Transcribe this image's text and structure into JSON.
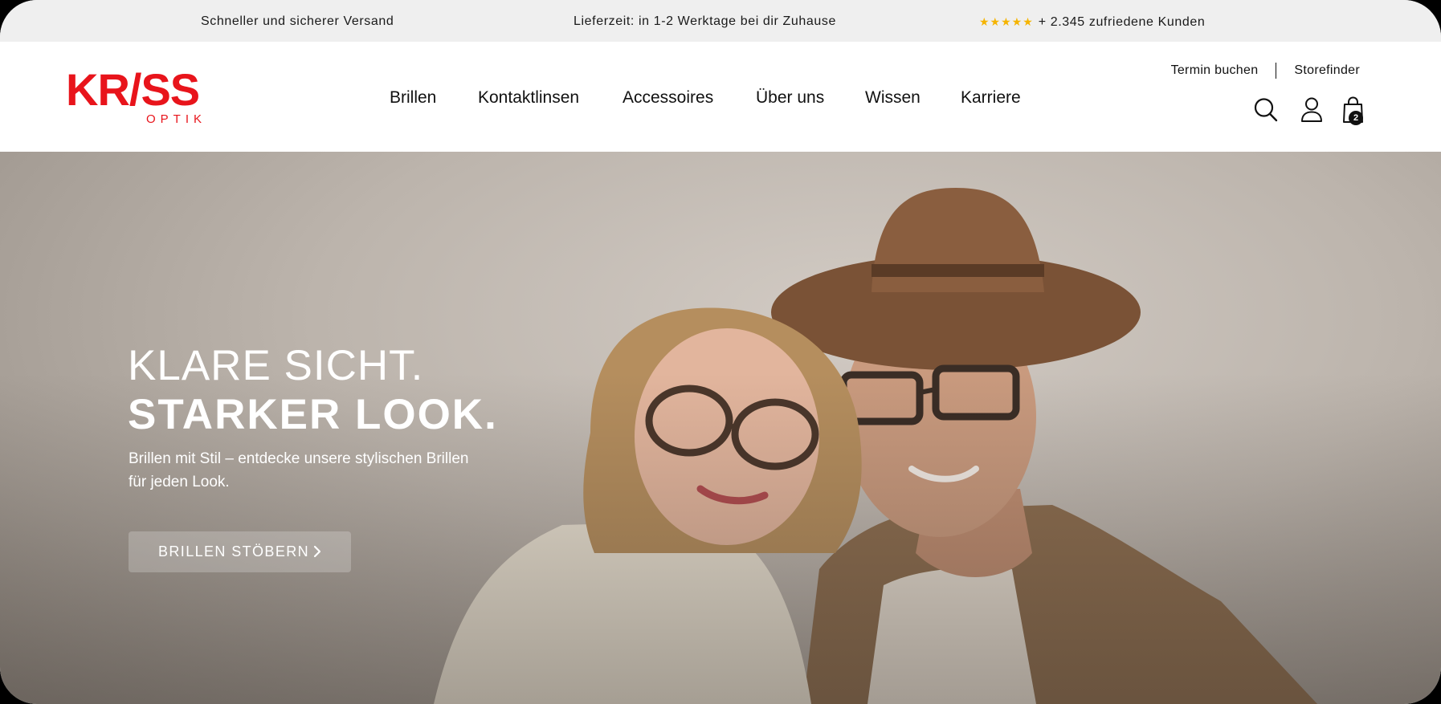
{
  "topbar": {
    "shipping": "Schneller und sicherer Versand",
    "delivery": "Lieferzeit: in 1-2 Werktage bei dir Zuhause",
    "stars": "★★★★★",
    "customers": "+ 2.345 zufriedene Kunden"
  },
  "brand": {
    "logo_text": "KR/SS",
    "logo_sub": "OPTIK",
    "accent_color": "#e8141b"
  },
  "nav": {
    "items": [
      {
        "label": "Brillen"
      },
      {
        "label": "Kontaktlinsen"
      },
      {
        "label": "Accessoires"
      },
      {
        "label": "Über uns"
      },
      {
        "label": "Wissen"
      },
      {
        "label": "Karriere"
      }
    ]
  },
  "utility": {
    "appointment": "Termin buchen",
    "storefinder": "Storefinder"
  },
  "icons": {
    "search": "search-icon",
    "account": "user-icon",
    "cart": "shopping-bag-icon",
    "cart_count": "2"
  },
  "hero": {
    "title_light": "KLARE SICHT.",
    "title_bold": "STARKER LOOK.",
    "text": "Brillen mit Stil – entdecke unsere stylischen Brillen für jeden Look.",
    "cta_label": "BRILLEN STÖBERN"
  }
}
